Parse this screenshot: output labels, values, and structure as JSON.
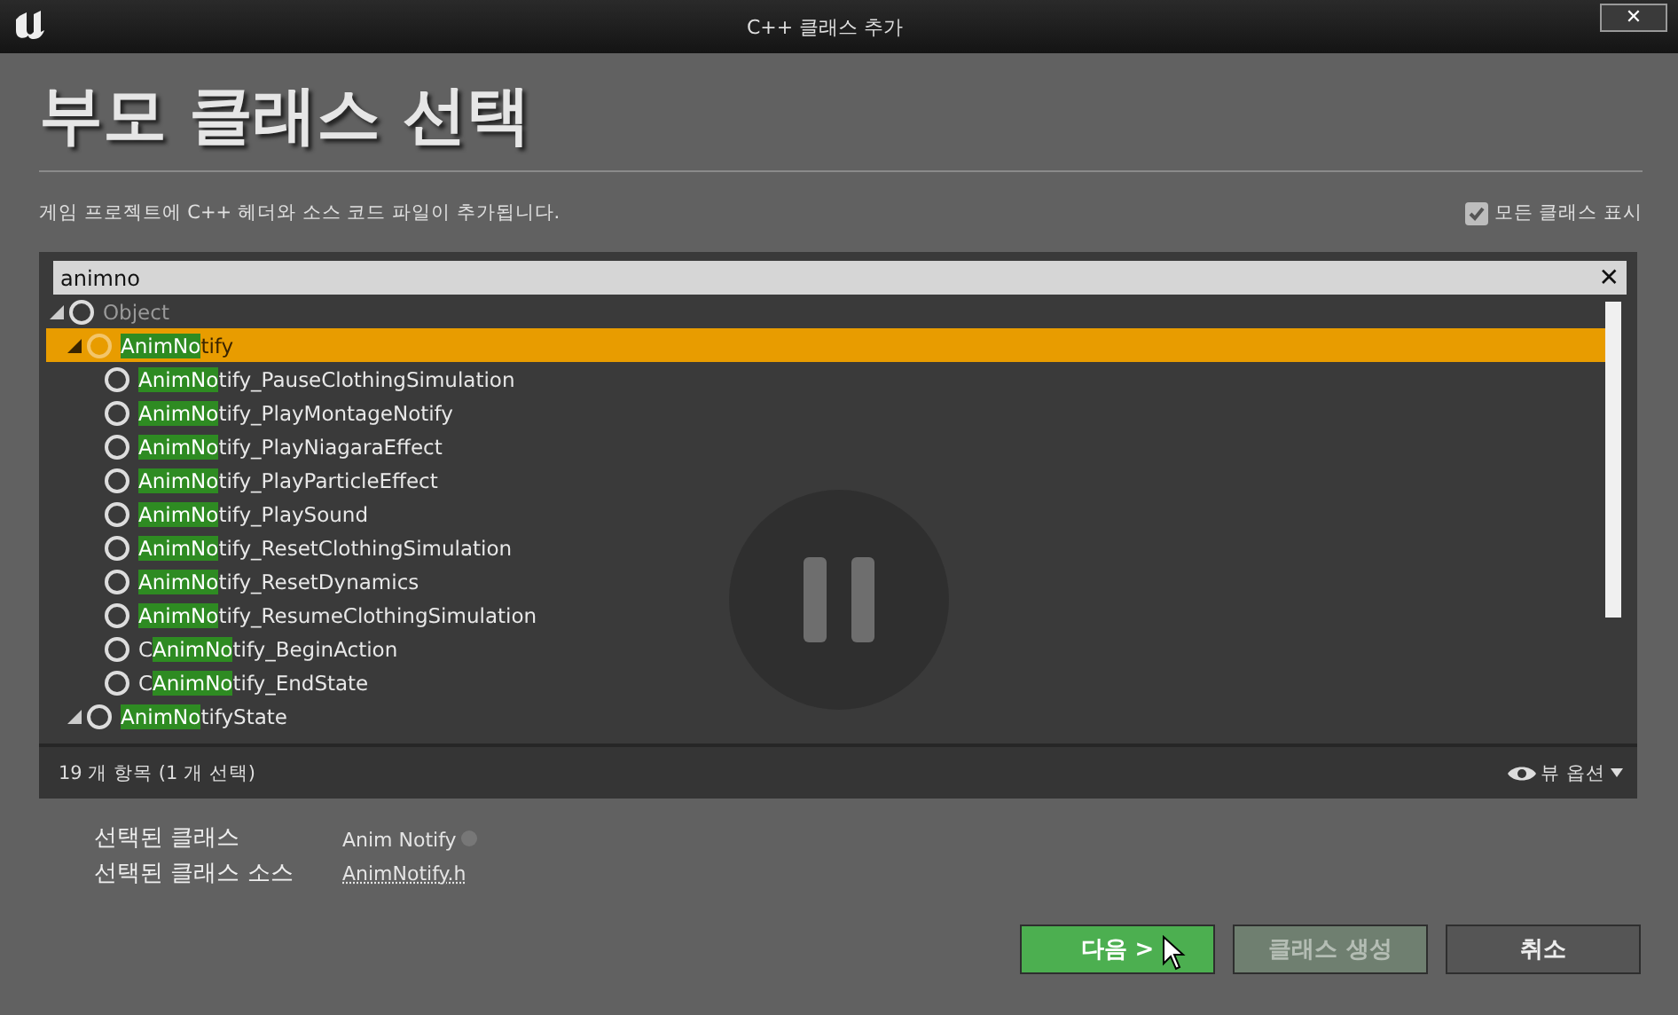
{
  "window": {
    "title": "C++ 클래스 추가",
    "close": "✕"
  },
  "heading": "부모 클래스 선택",
  "description": "게임 프로젝트에 C++ 헤더와 소스 코드 파일이 추가됩니다.",
  "show_all_classes": {
    "label": "모든 클래스 표시",
    "checked": true
  },
  "search": {
    "value": "animno",
    "clear": "✕"
  },
  "tree": [
    {
      "after": "Object",
      "disabled": true,
      "selected": false,
      "expanded": true,
      "children": [
        {
          "match": "AnimNo",
          "after": "tify",
          "disabled": false,
          "selected": true,
          "expanded": true,
          "children": [
            {
              "match": "AnimNo",
              "after": "tify_PauseClothingSimulation",
              "disabled": false,
              "selected": false
            },
            {
              "match": "AnimNo",
              "after": "tify_PlayMontageNotify",
              "disabled": false,
              "selected": false
            },
            {
              "match": "AnimNo",
              "after": "tify_PlayNiagaraEffect",
              "disabled": false,
              "selected": false
            },
            {
              "match": "AnimNo",
              "after": "tify_PlayParticleEffect",
              "disabled": false,
              "selected": false
            },
            {
              "match": "AnimNo",
              "after": "tify_PlaySound",
              "disabled": false,
              "selected": false
            },
            {
              "match": "AnimNo",
              "after": "tify_ResetClothingSimulation",
              "disabled": false,
              "selected": false
            },
            {
              "match": "AnimNo",
              "after": "tify_ResetDynamics",
              "disabled": false,
              "selected": false
            },
            {
              "match": "AnimNo",
              "after": "tify_ResumeClothingSimulation",
              "disabled": false,
              "selected": false
            },
            {
              "before": "C",
              "match": "AnimNo",
              "after": "tify_BeginAction",
              "disabled": false,
              "selected": false
            },
            {
              "before": "C",
              "match": "AnimNo",
              "after": "tify_EndState",
              "disabled": false,
              "selected": false
            }
          ]
        },
        {
          "match": "AnimNo",
          "after": "tifyState",
          "disabled": false,
          "selected": false,
          "expanded": true
        }
      ]
    }
  ],
  "status": "19 개 항목 (1 개 선택)",
  "view_options": "뷰 옵션",
  "selected_class": {
    "label": "선택된 클래스",
    "value": "Anim Notify"
  },
  "selected_source": {
    "label": "선택된 클래스 소스",
    "value": "AnimNotify.h"
  },
  "buttons": [
    {
      "label": "다음 >",
      "kind": "primary",
      "disabled": false
    },
    {
      "label": "클래스 생성",
      "kind": "primary",
      "disabled": true
    },
    {
      "label": "취소",
      "kind": "normal",
      "disabled": false
    }
  ]
}
